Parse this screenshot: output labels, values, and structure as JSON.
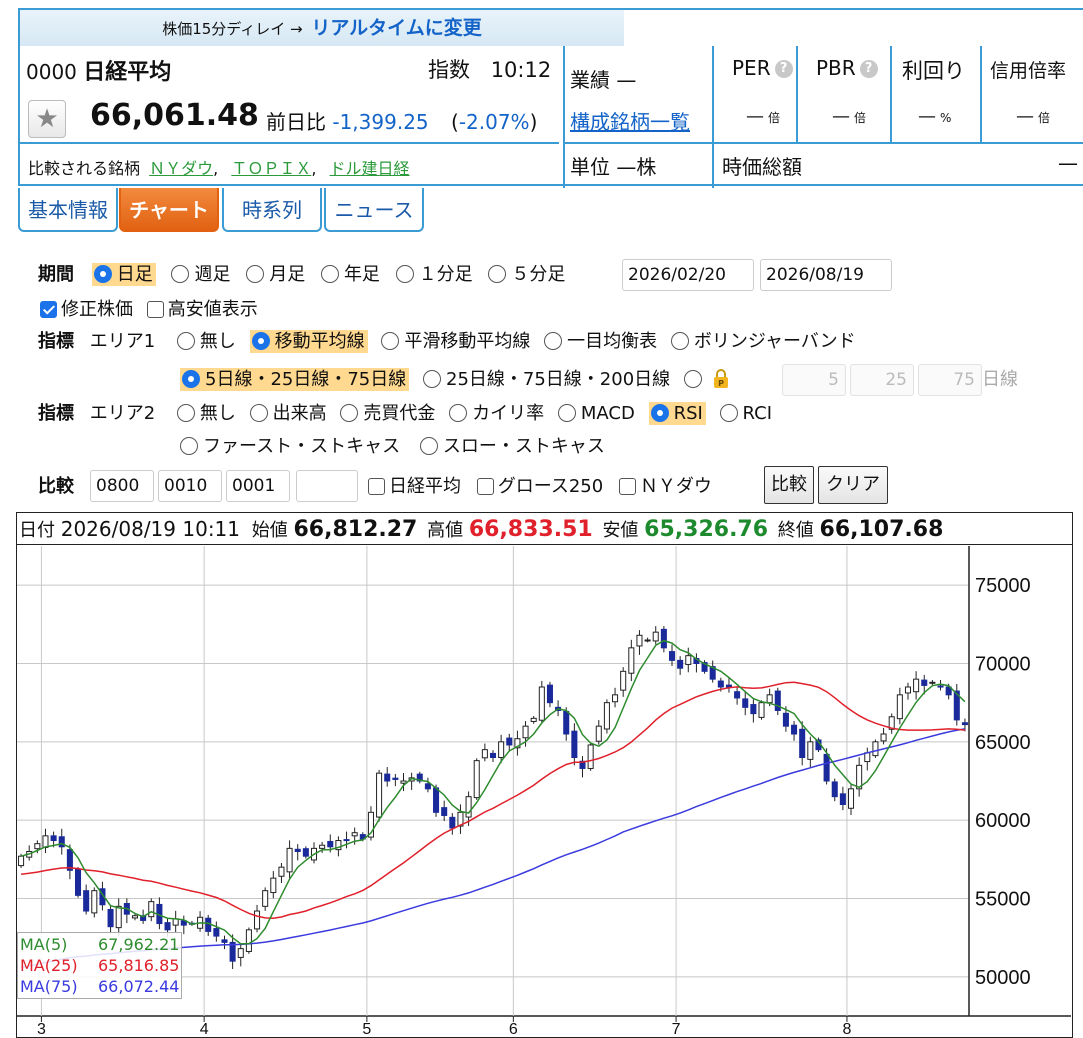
{
  "header": {
    "delay_note": "株価15分ディレイ →",
    "realtime_link": "リアルタイムに変更",
    "code": "0000",
    "name": "日経平均",
    "kind": "指数",
    "time": "10:12",
    "price": "66,061.48",
    "change_label": "前日比",
    "change": "-1,399.25",
    "change_pct_open": "(",
    "change_pct": "-2.07%",
    "change_pct_close": ")",
    "compare_label": "比較される銘柄",
    "compare_links": [
      "ＮＹダウ",
      "ＴＯＰＩＸ",
      "ドル建日経"
    ],
    "sep": ",",
    "gyoseki": "業績 —",
    "constituents": "構成銘柄一覧",
    "unit": "単位 —株",
    "per_label": "PER",
    "pbr_label": "PBR",
    "yield_label": "利回り",
    "margin_label": "信用倍率",
    "dash": "—",
    "times_unit": "倍",
    "pct_unit": "%",
    "market_cap_label": "時価総額",
    "market_cap": "—",
    "help_icon": "?"
  },
  "tabs": [
    "基本情報",
    "チャート",
    "時系列",
    "ニュース"
  ],
  "controls": {
    "period_label": "期間",
    "periods": [
      "日足",
      "週足",
      "月足",
      "年足",
      "１分足",
      "５分足"
    ],
    "selected_period": 0,
    "date_from": "2026/02/20",
    "date_to": "2026/08/19",
    "adjusted": "修正株価",
    "hilo": "高安値表示",
    "indicator_label": "指標",
    "area1_label": "エリア1",
    "area1_options": [
      "無し",
      "移動平均線",
      "平滑移動平均線",
      "一目均衡表",
      "ボリンジャーバンド"
    ],
    "area1_selected": 1,
    "ma_options": [
      "5日線・25日線・75日線",
      "25日線・75日線・200日線"
    ],
    "ma_custom": [
      "5",
      "25",
      "75"
    ],
    "ma_custom_unit": "日線",
    "area2_label": "エリア2",
    "area2_options": [
      "無し",
      "出来高",
      "売買代金",
      "カイリ率",
      "MACD",
      "RSI",
      "RCI"
    ],
    "area2_options_row2": [
      "ファースト・ストキャス",
      "スロー・ストキャス"
    ],
    "area2_selected": 5,
    "compare_label": "比較",
    "compare_codes": [
      "0800",
      "0010",
      "0001",
      ""
    ],
    "compare_checks": [
      "日経平均",
      "グロース250",
      "ＮＹダウ"
    ],
    "compare_button": "比較",
    "clear_button": "クリア"
  },
  "ohlc": {
    "date_label": "日付",
    "datetime": "2026/08/19 10:11",
    "open_label": "始値",
    "open": "66,812.27",
    "high_label": "高値",
    "high": "66,833.51",
    "low_label": "安値",
    "low": "65,326.76",
    "close_label": "終値",
    "close": "66,107.68"
  },
  "legend": [
    {
      "name": "MA(5)",
      "value": "67,962.21",
      "color": "#2e8b2e"
    },
    {
      "name": "MA(25)",
      "value": "65,816.85",
      "color": "#e0202a"
    },
    {
      "name": "MA(75)",
      "value": "66,072.44",
      "color": "#3a3adf"
    }
  ],
  "chart_data": {
    "type": "candlestick",
    "ylim": [
      47500,
      77500
    ],
    "yticks": [
      50000,
      55000,
      60000,
      65000,
      70000,
      75000
    ],
    "x_month_labels": [
      "3",
      "4",
      "5",
      "6",
      "7",
      "8"
    ],
    "x_month_start_index": [
      3,
      23,
      43,
      61,
      81,
      102
    ],
    "n_bars": 117,
    "colors": {
      "up": "#ffffff",
      "down": "#1a2a9a",
      "ma5": "#2e8b2e",
      "ma25": "#e0202a",
      "ma75": "#3a3adf"
    },
    "closes": [
      57700,
      58000,
      58500,
      59000,
      58700,
      58300,
      56800,
      55200,
      54200,
      55500,
      54600,
      53200,
      54500,
      54000,
      53900,
      53600,
      54800,
      53400,
      53000,
      53700,
      53300,
      53400,
      53800,
      52900,
      52600,
      52200,
      51000,
      51800,
      53000,
      54200,
      55500,
      56300,
      57000,
      58200,
      58000,
      57700,
      58200,
      58400,
      58300,
      58700,
      58700,
      59200,
      58800,
      60500,
      63000,
      62500,
      62600,
      62500,
      62700,
      62500,
      62000,
      60500,
      60300,
      59500,
      60500,
      61500,
      63800,
      64500,
      64000,
      65000,
      64800,
      65200,
      66000,
      66500,
      68500,
      67500,
      67000,
      65500,
      64000,
      63300,
      64800,
      66000,
      67500,
      68000,
      69500,
      71000,
      71800,
      71500,
      72000,
      71000,
      70200,
      69700,
      70500,
      70000,
      69500,
      69000,
      68500,
      68500,
      67800,
      67200,
      66800,
      67500,
      68000,
      67000,
      66000,
      65500,
      64000,
      65000,
      64500,
      62500,
      61500,
      61000,
      62000,
      63500,
      64300,
      65000,
      65500,
      66600,
      68000,
      68500,
      69000,
      68600,
      68800,
      68500,
      68000,
      66400,
      66100
    ],
    "ma5_end": 67962.21,
    "ma25_end": 65816.85,
    "ma75_end": 66072.44
  }
}
